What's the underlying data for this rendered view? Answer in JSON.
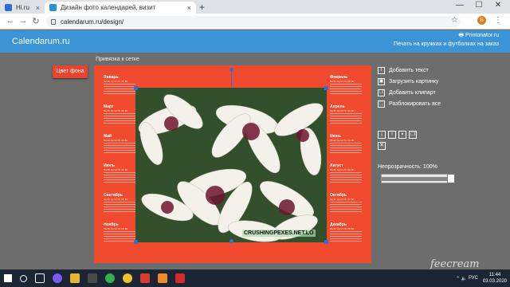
{
  "browser": {
    "tabs": [
      {
        "title": "Hi.ru",
        "close": "×",
        "favicon_color": "#2d6bd6"
      },
      {
        "title": "Дизайн фото календарей, визит",
        "close": "×",
        "favicon_color": "#2d8fd8"
      }
    ],
    "new_tab": "+",
    "url": "calendarum.ru/design/",
    "avatar_letter": "Б",
    "window_controls": [
      "—",
      "☐",
      "✕"
    ]
  },
  "site": {
    "logo": "Calendarum.ru",
    "printonator": "Printonator.ru",
    "slogan": "Печать на кружках и футболках на заказ"
  },
  "workspace": {
    "snap_label": "Привязка к сетке",
    "bg_color_button": "Цвет фона",
    "watermark": "CRUSHINGPEXES.NET.LO",
    "months_left": [
      "Январь",
      "Март",
      "Май",
      "Июль",
      "Сентябрь",
      "Ноябрь"
    ],
    "months_right": [
      "Февраль",
      "Апрель",
      "Июнь",
      "Август",
      "Октябрь",
      "Декабрь"
    ],
    "day_header": "Пн Вт Ср Чт Пт Сб Вс"
  },
  "tools": {
    "add_text": "Добавить текст",
    "upload_image": "Загрузить картинку",
    "add_clipart": "Добавить клипарт",
    "ungroup": "Разблокировать все",
    "opacity_label": "Непрозрачность: 100%",
    "opacity_value": 1.0
  },
  "overlay": {
    "brand": "feecream"
  },
  "taskbar": {
    "lang": "РУС",
    "time": "11:44",
    "date": "03.03.2020"
  },
  "colors": {
    "accent": "#3a94d6",
    "canvas": "#f04a2f",
    "taskbar": "#1b2533"
  }
}
